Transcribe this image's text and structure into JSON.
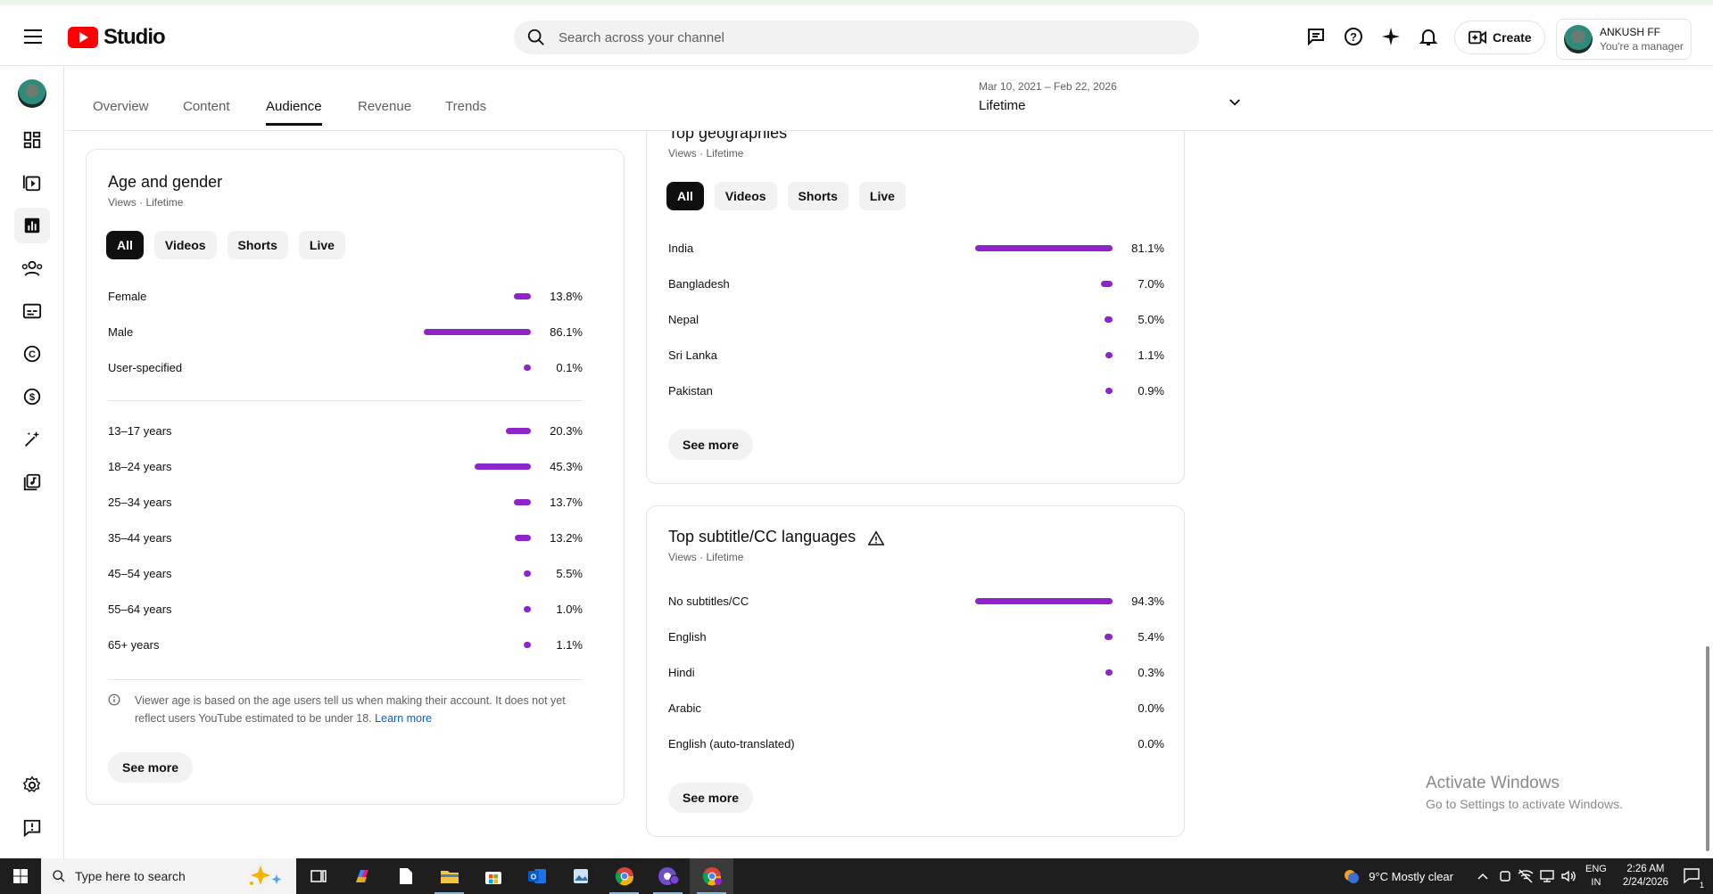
{
  "header": {
    "logo_text": "Studio",
    "search_placeholder": "Search across your channel",
    "create_label": "Create",
    "account_name": "ANKUSH FF",
    "account_role": "You're a manager"
  },
  "tabs": {
    "items": [
      "Overview",
      "Content",
      "Audience",
      "Revenue",
      "Trends"
    ],
    "active": "Audience",
    "date_range": "Mar 10, 2021 – Feb 22, 2026",
    "date_period": "Lifetime"
  },
  "age_gender": {
    "title": "Age and gender",
    "subtitle": "Views · Lifetime",
    "chips": [
      "All",
      "Videos",
      "Shorts",
      "Live"
    ],
    "gender": [
      {
        "label": "Female",
        "pct": "13.8%",
        "value": 13.8
      },
      {
        "label": "Male",
        "pct": "86.1%",
        "value": 86.1
      },
      {
        "label": "User-specified",
        "pct": "0.1%",
        "value": 0.1
      }
    ],
    "ages": [
      {
        "label": "13–17 years",
        "pct": "20.3%",
        "value": 20.3
      },
      {
        "label": "18–24 years",
        "pct": "45.3%",
        "value": 45.3
      },
      {
        "label": "25–34 years",
        "pct": "13.7%",
        "value": 13.7
      },
      {
        "label": "35–44 years",
        "pct": "13.2%",
        "value": 13.2
      },
      {
        "label": "45–54 years",
        "pct": "5.5%",
        "value": 5.5
      },
      {
        "label": "55–64 years",
        "pct": "1.0%",
        "value": 1.0
      },
      {
        "label": "65+ years",
        "pct": "1.1%",
        "value": 1.1
      }
    ],
    "note": "Viewer age is based on the age users tell us when making their account. It does not yet reflect users YouTube estimated to be under 18.",
    "note_link": "Learn more",
    "see_more": "See more"
  },
  "geographies": {
    "title": "Top geographies",
    "subtitle": "Views · Lifetime",
    "chips": [
      "All",
      "Videos",
      "Shorts",
      "Live"
    ],
    "rows": [
      {
        "label": "India",
        "pct": "81.1%",
        "value": 81.1
      },
      {
        "label": "Bangladesh",
        "pct": "7.0%",
        "value": 7.0
      },
      {
        "label": "Nepal",
        "pct": "5.0%",
        "value": 5.0
      },
      {
        "label": "Sri Lanka",
        "pct": "1.1%",
        "value": 1.1
      },
      {
        "label": "Pakistan",
        "pct": "0.9%",
        "value": 0.9
      }
    ],
    "see_more": "See more"
  },
  "subtitles": {
    "title": "Top subtitle/CC languages",
    "subtitle": "Views · Lifetime",
    "rows": [
      {
        "label": "No subtitles/CC",
        "pct": "94.3%",
        "value": 94.3
      },
      {
        "label": "English",
        "pct": "5.4%",
        "value": 5.4
      },
      {
        "label": "Hindi",
        "pct": "0.3%",
        "value": 0.3
      },
      {
        "label": "Arabic",
        "pct": "0.0%",
        "value": 0.0
      },
      {
        "label": "English (auto-translated)",
        "pct": "0.0%",
        "value": 0.0
      }
    ],
    "see_more": "See more"
  },
  "watermark": {
    "line1": "Activate Windows",
    "line2": "Go to Settings to activate Windows."
  },
  "taskbar": {
    "search_placeholder": "Type here to search",
    "weather": "9°C  Mostly clear",
    "lang1": "ENG",
    "lang2": "IN",
    "time": "2:26 AM",
    "date": "2/24/2026",
    "notification_count": "1"
  },
  "colors": {
    "bar": "#8e24c9",
    "brand": "#ff0000"
  }
}
